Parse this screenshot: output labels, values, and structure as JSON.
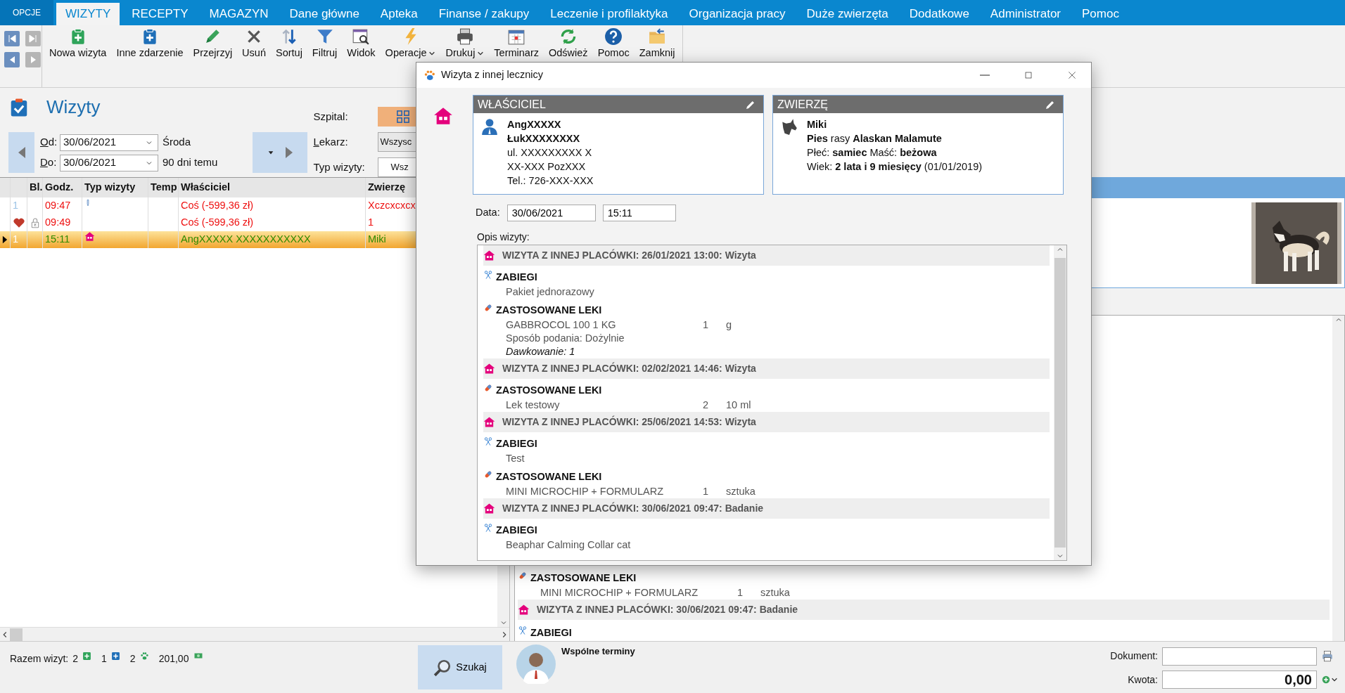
{
  "menu": [
    {
      "label": "OPCJE",
      "kind": "options",
      "selected": false
    },
    {
      "label": "WIZYTY",
      "kind": "tab",
      "selected": true
    },
    {
      "label": "RECEPTY",
      "kind": "tab",
      "selected": false
    },
    {
      "label": "MAGAZYN",
      "kind": "tab",
      "selected": false
    },
    {
      "label": "Dane główne",
      "kind": "tab",
      "selected": false
    },
    {
      "label": "Apteka",
      "kind": "tab",
      "selected": false
    },
    {
      "label": "Finanse / zakupy",
      "kind": "tab",
      "selected": false
    },
    {
      "label": "Leczenie i profilaktyka",
      "kind": "tab",
      "selected": false
    },
    {
      "label": "Organizacja pracy",
      "kind": "tab",
      "selected": false
    },
    {
      "label": "Duże zwierzęta",
      "kind": "tab",
      "selected": false
    },
    {
      "label": "Dodatkowe",
      "kind": "tab",
      "selected": false
    },
    {
      "label": "Administrator",
      "kind": "tab",
      "selected": false
    },
    {
      "label": "Pomoc",
      "kind": "tab",
      "selected": false
    }
  ],
  "toolbar": [
    {
      "label": "Nowa wizyta",
      "has_menu": false
    },
    {
      "label": "Inne zdarzenie",
      "has_menu": false
    },
    {
      "label": "Przejrzyj",
      "has_menu": false
    },
    {
      "label": "Usuń",
      "has_menu": false
    },
    {
      "label": "Sortuj",
      "has_menu": false
    },
    {
      "label": "Filtruj",
      "has_menu": false
    },
    {
      "label": "Widok",
      "has_menu": false
    },
    {
      "label": "Operacje",
      "has_menu": true
    },
    {
      "label": "Drukuj",
      "has_menu": true
    },
    {
      "label": "Terminarz",
      "has_menu": false
    },
    {
      "label": "Odśwież",
      "has_menu": false
    },
    {
      "label": "Pomoc",
      "has_menu": false
    },
    {
      "label": "Zamknij",
      "has_menu": false
    }
  ],
  "visits_panel": {
    "title": "Wizyty",
    "from_label": "Od:",
    "from": "30/06/2021",
    "weekday": "Środa",
    "to_label": "Do:",
    "to": "30/06/2021",
    "ago": "90 dni temu",
    "hospital_label": "Szpital:",
    "doctor_label": "Lekarz:",
    "doctor": "Wszysc",
    "type_label": "Typ wizyty:",
    "type": "Wsz"
  },
  "table": {
    "columns": [
      "Bl.",
      "Godz.",
      "Typ wizyty",
      "Temp",
      "Właściciel",
      "Zwierzę"
    ],
    "rows": [
      {
        "kind": "examination",
        "number": "1",
        "time": "09:47",
        "owner": "Coś (-599,36 zł)",
        "animal": "Xczcxcxcx",
        "marked": false,
        "locked": false,
        "selected": false,
        "debt": true
      },
      {
        "kind": "plain",
        "time": "09:49",
        "owner": "Coś (-599,36 zł)",
        "animal": "1",
        "marked": true,
        "locked": true,
        "selected": false,
        "debt": true
      },
      {
        "kind": "external",
        "number": "1",
        "time": "15:11",
        "owner": "AngXXXXX XXXXXXXXXXX",
        "animal": "Miki",
        "marked": false,
        "locked": false,
        "selected": true,
        "debt": false
      }
    ]
  },
  "background_list": [
    {
      "kind": "drug_section",
      "text": "ZASTOSOWANE LEKI"
    },
    {
      "kind": "item",
      "name": "MINI  MICROCHIP + FORMULARZ",
      "qty": "1",
      "unit": "sztuka"
    },
    {
      "kind": "visit_header",
      "text": "WIZYTA Z INNEJ PLACÓWKI: 30/06/2021 09:47: Badanie"
    },
    {
      "kind": "procedure_section",
      "text": "ZABIEGI"
    }
  ],
  "status_bar": {
    "label": "Razem wizyt:",
    "new_count": "2",
    "other_count": "1",
    "animal_count": "2",
    "amount": "201,00",
    "search_button": "Szukaj",
    "shared_schedule": "Wspólne terminy",
    "document_label": "Dokument:",
    "total_label": "Kwota:",
    "total": "0,00"
  },
  "dialog": {
    "title": "Wizyta z innej lecznicy",
    "owner": {
      "header": "WŁAŚCICIEL",
      "lines": [
        {
          "text": "AngXXXXX",
          "bold": true
        },
        {
          "text": "ŁukXXXXXXXX",
          "bold": true
        },
        {
          "text": "ul. XXXXXXXXX X",
          "bold": false
        },
        {
          "text": "XX-XXX  PozXXX",
          "bold": false
        },
        {
          "text": "Tel.: 726-XXX-XXX",
          "bold": false
        }
      ]
    },
    "animal": {
      "header": "ZWIERZĘ",
      "lines": [
        {
          "text": "Miki",
          "bold": true
        },
        {
          "text": "**Pies** rasy **Alaskan Malamute**",
          "bold": false
        },
        {
          "text": "Płeć: **samiec**  Maść: **beżowa**",
          "bold": false
        },
        {
          "text": "Wiek: **2 lata i 9 miesięcy** (01/01/2019)",
          "bold": false
        }
      ]
    },
    "date_label": "Data:",
    "date": "30/06/2021",
    "time": "15:11",
    "description_label": "Opis wizyty:",
    "entries": [
      {
        "kind": "visit_header",
        "text": "WIZYTA Z INNEJ PLACÓWKI: 26/01/2021 13:00: Wizyta"
      },
      {
        "kind": "procedure_section",
        "text": "ZABIEGI"
      },
      {
        "kind": "text",
        "text": "Pakiet jednorazowy"
      },
      {
        "kind": "drug_section",
        "text": "ZASTOSOWANE LEKI"
      },
      {
        "kind": "item",
        "name": "GABBROCOL 100   1 KG",
        "qty": "1",
        "unit": "g"
      },
      {
        "kind": "text",
        "text": "Sposób podania: Dożylnie"
      },
      {
        "kind": "dosage",
        "text": "Dawkowanie: 1"
      },
      {
        "kind": "visit_header",
        "text": "WIZYTA Z INNEJ PLACÓWKI: 02/02/2021 14:46: Wizyta"
      },
      {
        "kind": "drug_section",
        "text": "ZASTOSOWANE LEKI"
      },
      {
        "kind": "item",
        "name": "Lek testowy",
        "qty": "2",
        "unit": "10 ml"
      },
      {
        "kind": "visit_header",
        "text": "WIZYTA Z INNEJ PLACÓWKI: 25/06/2021 14:53: Wizyta"
      },
      {
        "kind": "procedure_section",
        "text": "ZABIEGI"
      },
      {
        "kind": "text",
        "text": "Test"
      },
      {
        "kind": "drug_section",
        "text": "ZASTOSOWANE LEKI"
      },
      {
        "kind": "item",
        "name": "MINI  MICROCHIP + FORMULARZ",
        "qty": "1",
        "unit": "sztuka"
      },
      {
        "kind": "visit_header",
        "text": "WIZYTA Z INNEJ PLACÓWKI: 30/06/2021 09:47: Badanie"
      },
      {
        "kind": "procedure_section",
        "text": "ZABIEGI"
      },
      {
        "kind": "text",
        "text": "Beaphar Calming Collar cat"
      }
    ]
  }
}
